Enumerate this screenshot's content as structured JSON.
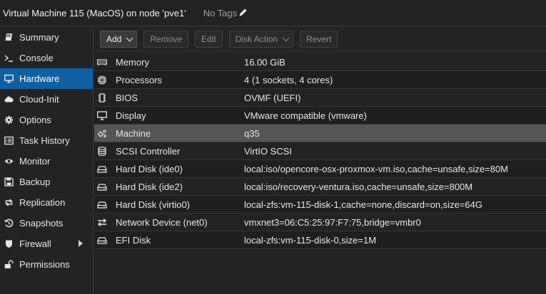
{
  "header": {
    "title": "Virtual Machine 115 (MacOS) on node 'pve1'",
    "tags_label": "No Tags"
  },
  "sidebar": {
    "items": [
      {
        "label": "Summary",
        "icon": "book-icon"
      },
      {
        "label": "Console",
        "icon": "terminal-icon"
      },
      {
        "label": "Hardware",
        "icon": "monitor-icon",
        "active": true
      },
      {
        "label": "Cloud-Init",
        "icon": "cloud-icon"
      },
      {
        "label": "Options",
        "icon": "gear-icon"
      },
      {
        "label": "Task History",
        "icon": "list-icon"
      },
      {
        "label": "Monitor",
        "icon": "eye-icon"
      },
      {
        "label": "Backup",
        "icon": "floppy-icon"
      },
      {
        "label": "Replication",
        "icon": "retweet-icon"
      },
      {
        "label": "Snapshots",
        "icon": "history-icon"
      },
      {
        "label": "Firewall",
        "icon": "shield-icon",
        "expandable": true
      },
      {
        "label": "Permissions",
        "icon": "unlock-icon"
      }
    ]
  },
  "toolbar": {
    "add_label": "Add",
    "remove_label": "Remove",
    "edit_label": "Edit",
    "disk_action_label": "Disk Action",
    "revert_label": "Revert"
  },
  "hardware": {
    "rows": [
      {
        "name": "Memory",
        "value": "16.00 GiB",
        "icon": "memory-icon"
      },
      {
        "name": "Processors",
        "value": "4 (1 sockets, 4 cores)",
        "icon": "cpu-icon"
      },
      {
        "name": "BIOS",
        "value": "OVMF (UEFI)",
        "icon": "microchip-icon"
      },
      {
        "name": "Display",
        "value": "VMware compatible (vmware)",
        "icon": "desktop-icon"
      },
      {
        "name": "Machine",
        "value": "q35",
        "icon": "cogs-icon",
        "selected": true
      },
      {
        "name": "SCSI Controller",
        "value": "VirtIO SCSI",
        "icon": "database-icon"
      },
      {
        "name": "Hard Disk (ide0)",
        "value": "local:iso/opencore-osx-proxmox-vm.iso,cache=unsafe,size=80M",
        "icon": "hdd-icon"
      },
      {
        "name": "Hard Disk (ide2)",
        "value": "local:iso/recovery-ventura.iso,cache=unsafe,size=800M",
        "icon": "hdd-icon"
      },
      {
        "name": "Hard Disk (virtio0)",
        "value": "local-zfs:vm-115-disk-1,cache=none,discard=on,size=64G",
        "icon": "hdd-icon"
      },
      {
        "name": "Network Device (net0)",
        "value": "vmxnet3=06:C5:25:97:F7:75,bridge=vmbr0",
        "icon": "exchange-icon"
      },
      {
        "name": "EFI Disk",
        "value": "local-zfs:vm-115-disk-0,size=1M",
        "icon": "hdd-icon"
      }
    ]
  },
  "colors": {
    "accent": "#0f5fa3",
    "selected_row": "#555555",
    "background": "#232323"
  }
}
